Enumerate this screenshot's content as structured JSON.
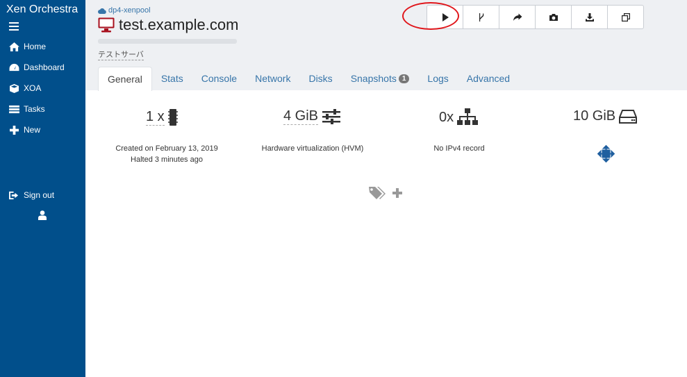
{
  "sidebar": {
    "brand": "Xen Orchestra",
    "items": [
      {
        "label": "Home",
        "icon": "home-icon"
      },
      {
        "label": "Dashboard",
        "icon": "dashboard-icon"
      },
      {
        "label": "XOA",
        "icon": "cube-icon"
      },
      {
        "label": "Tasks",
        "icon": "tasks-icon"
      },
      {
        "label": "New",
        "icon": "plus-icon"
      }
    ],
    "signout": "Sign out"
  },
  "header": {
    "pool": "dp4-xenpool",
    "vm_name": "test.example.com",
    "description": "テストサーバ"
  },
  "toolbar": {
    "buttons": [
      "start-icon",
      "fork-icon",
      "migrate-icon",
      "snapshot-icon",
      "export-icon",
      "copy-icon"
    ]
  },
  "tabs": {
    "general": "General",
    "stats": "Stats",
    "console": "Console",
    "network": "Network",
    "disks": "Disks",
    "snapshots": "Snapshots",
    "snapshots_count": "1",
    "logs": "Logs",
    "advanced": "Advanced"
  },
  "stats": {
    "cpu": "1 x",
    "memory": "4 GiB",
    "network": "0x",
    "disk": "10 GiB"
  },
  "info": {
    "created": "Created on February 13, 2019",
    "halted": "Halted 3 minutes ago",
    "virtualization": "Hardware virtualization (HVM)",
    "ipv4": "No IPv4 record"
  },
  "colors": {
    "sidebar": "#014f8b",
    "link": "#3775a9",
    "vm_icon": "#a8101e",
    "highlight": "#e0161b"
  }
}
